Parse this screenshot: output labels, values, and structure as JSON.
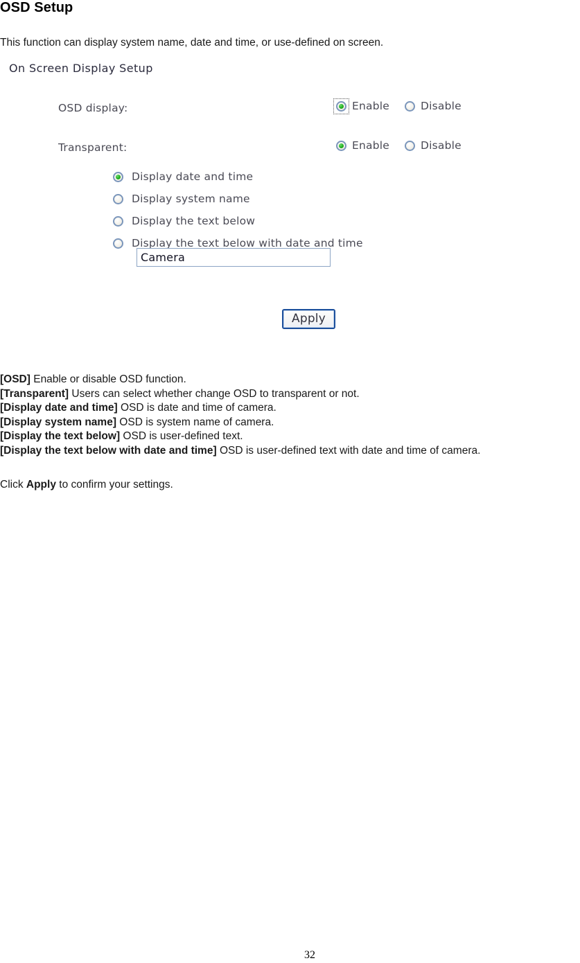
{
  "page": {
    "title": "OSD Setup",
    "intro": "This function can display system name, date and time, or use-defined on screen.",
    "number": "32"
  },
  "form": {
    "panel_title": "On Screen Display Setup",
    "fields": [
      {
        "label": "OSD display:",
        "options": [
          {
            "label": "Enable",
            "selected": true,
            "focused": true
          },
          {
            "label": "Disable",
            "selected": false,
            "focused": false
          }
        ]
      },
      {
        "label": "Transparent:",
        "options": [
          {
            "label": "Enable",
            "selected": true,
            "focused": false
          },
          {
            "label": "Disable",
            "selected": false,
            "focused": false
          }
        ]
      }
    ],
    "mode_options": [
      {
        "label": "Display date and time",
        "selected": true
      },
      {
        "label": "Display system name",
        "selected": false
      },
      {
        "label": "Display the text below",
        "selected": false
      },
      {
        "label": "Display the text below with date and time",
        "selected": false
      }
    ],
    "text_input": {
      "value": "Camera",
      "placeholder": ""
    },
    "apply_label": "Apply"
  },
  "descriptions": [
    {
      "term": "[OSD]",
      "text": " Enable or disable OSD function."
    },
    {
      "term": "[Transparent]",
      "text": " Users can select whether change OSD to transparent or not."
    },
    {
      "term": "[Display date and time]",
      "text": " OSD is date and time of camera."
    },
    {
      "term": "[Display system name]",
      "text": " OSD is system name of camera."
    },
    {
      "term": "[Display the text below]",
      "text": " OSD is user-defined text."
    },
    {
      "term": "[Display the text below with date and time]",
      "text": " OSD is user-defined text with date and time of camera."
    }
  ],
  "closing": {
    "pre": "Click ",
    "bold": "Apply",
    "post": " to confirm your settings."
  },
  "colors": {
    "radio_ring": "#7b96bb",
    "radio_dot": "#22b022",
    "input_border": "#8ca4c4",
    "button_border": "#1c4f9c",
    "label_text": "#4a4a55"
  }
}
